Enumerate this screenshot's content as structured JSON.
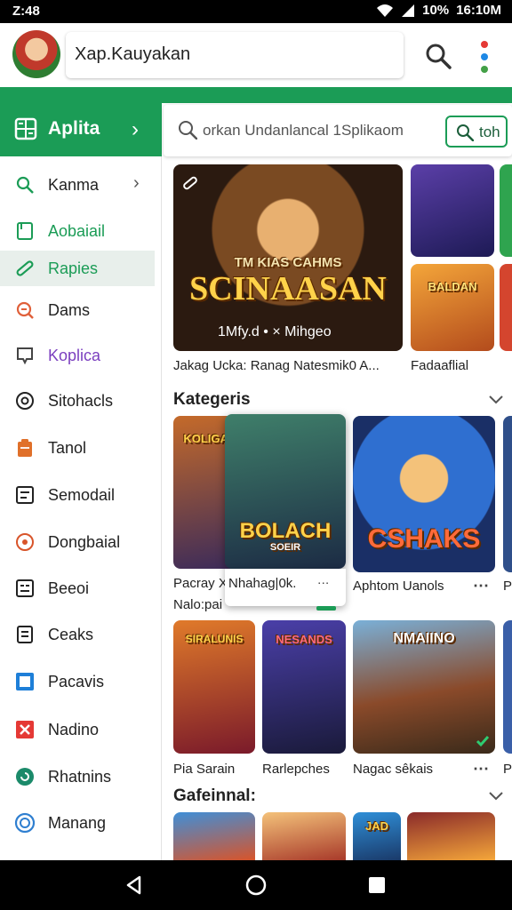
{
  "status": {
    "time": "Z:48",
    "battery": "10%",
    "clock_right": "16:10M"
  },
  "appbar": {
    "title": "Xap.Kauyakan",
    "search_icon": "search-icon",
    "more_icon": "more-vert-icon"
  },
  "sidebar": {
    "header": {
      "label": "Aplita",
      "icon": "grid-icon"
    },
    "items": [
      {
        "label": "Kanma",
        "icon": "search-icon",
        "color": "#1b9c56"
      },
      {
        "label": "Aobaiail",
        "icon": "tablet-icon",
        "color": "#1b9c56"
      },
      {
        "label": "Rapies",
        "icon": "link-icon",
        "color": "#1b9c56"
      },
      {
        "label": "Dams",
        "icon": "zoom-icon",
        "color": "#e0603a"
      },
      {
        "label": "Koplica",
        "icon": "chat-icon",
        "color": "#7b3fbf"
      },
      {
        "label": "Sitohacls",
        "icon": "target-icon",
        "color": "#222"
      },
      {
        "label": "Tanol",
        "icon": "clipboard-icon",
        "color": "#222"
      },
      {
        "label": "Semodail",
        "icon": "list-icon",
        "color": "#222"
      },
      {
        "label": "Dongbaial",
        "icon": "settings-icon",
        "color": "#222"
      },
      {
        "label": "Beeoi",
        "icon": "table-icon",
        "color": "#222"
      },
      {
        "label": "Ceaks",
        "icon": "document-icon",
        "color": "#222"
      },
      {
        "label": "Pacavis",
        "icon": "square-icon",
        "color": "#222"
      },
      {
        "label": "Nadino",
        "icon": "close-box-icon",
        "color": "#222"
      },
      {
        "label": "Rhatnins",
        "icon": "refresh-icon",
        "color": "#222"
      },
      {
        "label": "Manang",
        "icon": "circle-e-icon",
        "color": "#222"
      }
    ]
  },
  "search": {
    "placeholder": "orkan Undanlancal 1Splikaom",
    "button_label": "toh"
  },
  "featured": {
    "title_line1": "TM KIAS CAHMS",
    "title_line2": "SCINAASAN",
    "footer": "1Mfy.d • × Mihgeo",
    "caption_main": "Jakag Ucka: Ranag Natesmik0 A...",
    "caption_side": "Fadaaflial",
    "small_title": "BALDAN"
  },
  "section1": {
    "title": "Kategeris",
    "tiles": [
      {
        "title": "KOLIGAOS",
        "caption": "Pacray X"
      },
      {
        "title": "BOLACH",
        "subtitle": "SOEIR",
        "caption": "Nhahag|0k."
      },
      {
        "title": "CSHAKS",
        "caption": "Aphtom Uanols"
      }
    ],
    "extra_caption": "Nalo:pai",
    "edge_caption": "P"
  },
  "section2": {
    "tiles": [
      {
        "title": "SIRALUNIS",
        "caption": "Pia Sarain"
      },
      {
        "title": "NESANDS",
        "caption": "Rarlepches"
      },
      {
        "title": "NMAIINO",
        "caption": "Nagac sêkais"
      }
    ],
    "edge_caption": "P"
  },
  "section3": {
    "title": "Gafeinnal:",
    "tiles": [
      {
        "title": ""
      },
      {
        "title": ""
      },
      {
        "title": "JAD"
      },
      {
        "title": ""
      }
    ]
  }
}
